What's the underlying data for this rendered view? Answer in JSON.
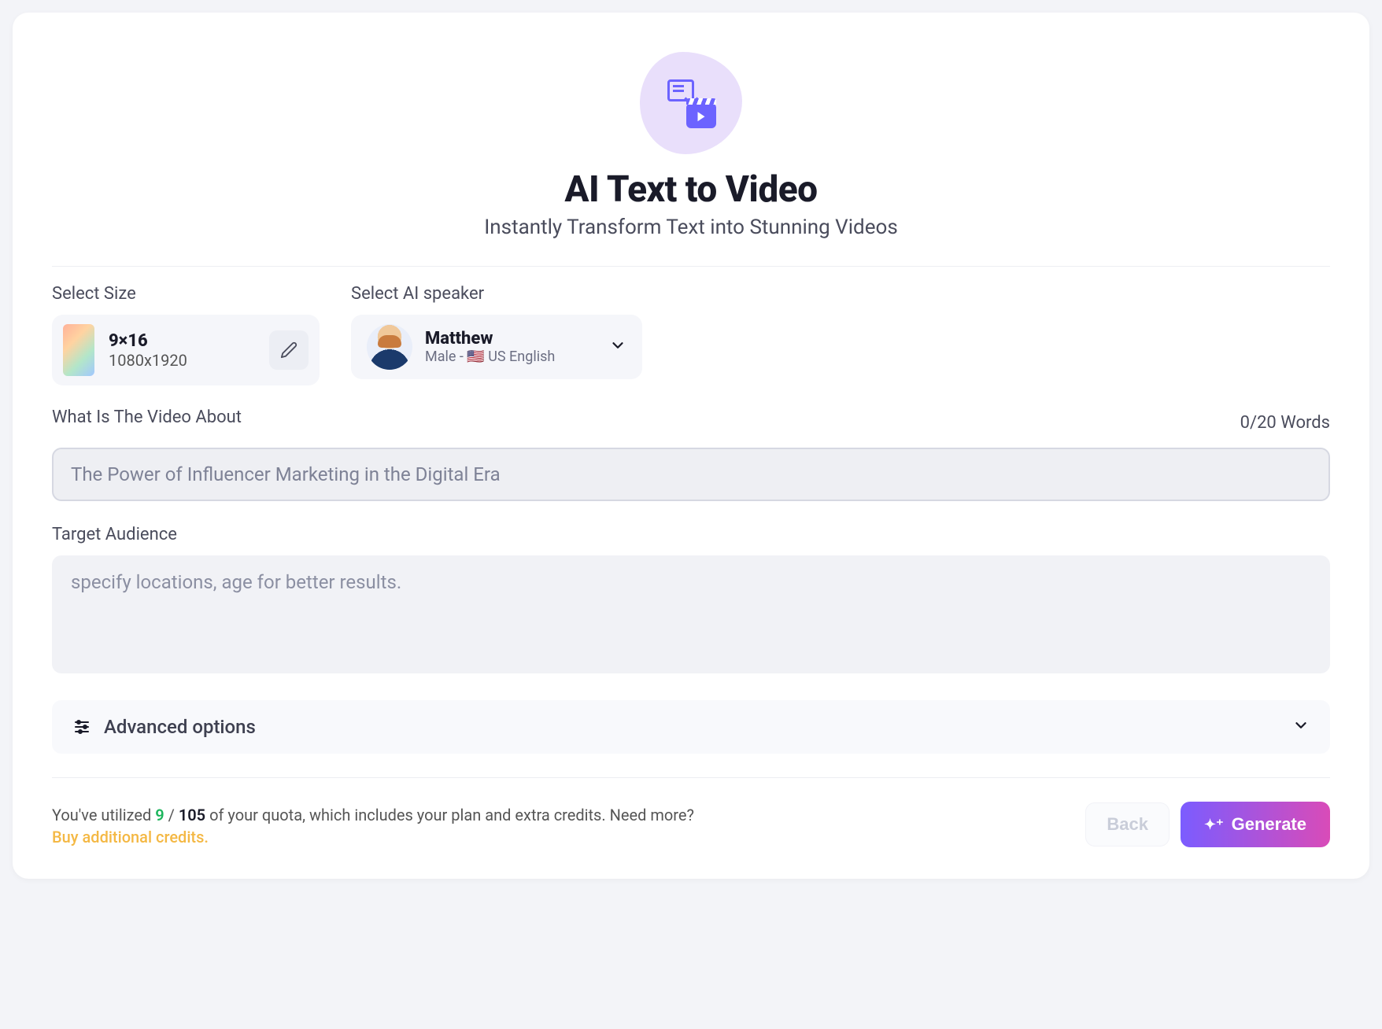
{
  "header": {
    "title": "AI Text to Video",
    "subtitle": "Instantly Transform Text into Stunning Videos"
  },
  "size": {
    "label": "Select Size",
    "ratio": "9×16",
    "dimensions": "1080x1920"
  },
  "speaker": {
    "label": "Select AI speaker",
    "name": "Matthew",
    "meta_prefix": "Male - ",
    "flag": "🇺🇸",
    "language": " US English"
  },
  "topic": {
    "label": "What Is The Video About",
    "counter": "0/20 Words",
    "placeholder": "The Power of Influencer Marketing in the Digital Era",
    "value": ""
  },
  "audience": {
    "label": "Target Audience",
    "placeholder": "specify locations, age for better results.",
    "value": ""
  },
  "advanced": {
    "label": "Advanced options"
  },
  "footer": {
    "quota_prefix": "You've utilized ",
    "used": "9",
    "sep": " / ",
    "total": "105",
    "quota_suffix": " of your quota, which includes your plan and extra credits. Need more?",
    "buy_link": "Buy additional credits.",
    "back": "Back",
    "generate": "Generate"
  }
}
